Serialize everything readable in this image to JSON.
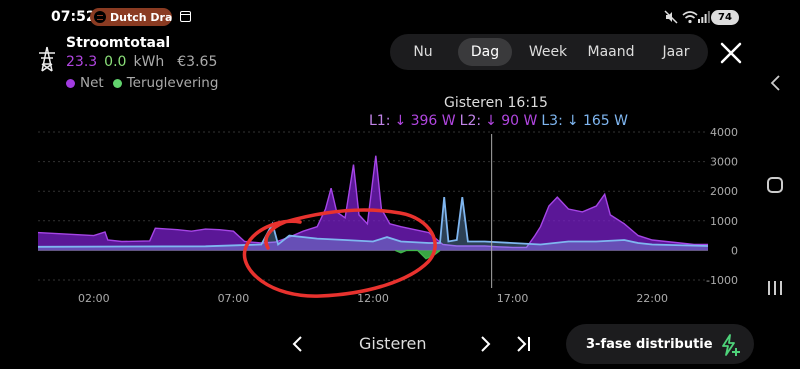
{
  "status_bar": {
    "time": "07:52",
    "notification": "Dutch Drag",
    "battery": "74"
  },
  "header": {
    "title": "Stroomtotaal",
    "net_value": "23.3",
    "return_value": "0.0",
    "unit": "kWh",
    "cost": "€3.65",
    "legend_net": "Net",
    "legend_return": "Teruglevering"
  },
  "tabs": [
    "Nu",
    "Dag",
    "Week",
    "Maand",
    "Jaar"
  ],
  "selected_tab": "Dag",
  "tooltip": {
    "time": "Gisteren 16:15",
    "l1_label": "L1:",
    "l1_value": "↓ 396 W",
    "l2_label": "L2:",
    "l2_value": "↓ 90 W",
    "l3_label": "L3:",
    "l3_value": "↓ 165 W"
  },
  "chart_data": {
    "type": "area",
    "y_ticks": [
      "4000",
      "3000",
      "2000",
      "1000",
      "0",
      "-1000"
    ],
    "ylim": [
      -1000,
      4000
    ],
    "x_ticks": [
      "02:00",
      "07:00",
      "12:00",
      "17:00",
      "22:00"
    ],
    "xlim_hours": [
      0,
      24
    ],
    "cursor_hour": 16.25,
    "series": [
      {
        "name": "Net",
        "color": "#7a1fc9",
        "values": [
          [
            0,
            600
          ],
          [
            1,
            550
          ],
          [
            2,
            500
          ],
          [
            2.4,
            620
          ],
          [
            2.5,
            350
          ],
          [
            3,
            300
          ],
          [
            4,
            320
          ],
          [
            4.2,
            750
          ],
          [
            5,
            700
          ],
          [
            5.5,
            650
          ],
          [
            6,
            720
          ],
          [
            6.5,
            700
          ],
          [
            7,
            650
          ],
          [
            7.4,
            300
          ],
          [
            8,
            250
          ],
          [
            8.5,
            280
          ],
          [
            9,
            450
          ],
          [
            9.5,
            650
          ],
          [
            10,
            800
          ],
          [
            10.3,
            1400
          ],
          [
            10.5,
            2100
          ],
          [
            10.7,
            1300
          ],
          [
            11,
            1100
          ],
          [
            11.3,
            2900
          ],
          [
            11.5,
            1200
          ],
          [
            11.8,
            900
          ],
          [
            12.1,
            3200
          ],
          [
            12.3,
            1400
          ],
          [
            12.6,
            900
          ],
          [
            13,
            800
          ],
          [
            13.5,
            700
          ],
          [
            14,
            600
          ],
          [
            14.5,
            200
          ],
          [
            15,
            150
          ],
          [
            16,
            150
          ],
          [
            16.5,
            120
          ],
          [
            17,
            100
          ],
          [
            17.5,
            100
          ],
          [
            17.8,
            500
          ],
          [
            18,
            800
          ],
          [
            18.3,
            1500
          ],
          [
            18.6,
            1800
          ],
          [
            19,
            1400
          ],
          [
            19.5,
            1300
          ],
          [
            20,
            1500
          ],
          [
            20.3,
            1900
          ],
          [
            20.5,
            1200
          ],
          [
            21,
            900
          ],
          [
            21.5,
            500
          ],
          [
            22,
            350
          ],
          [
            23,
            250
          ],
          [
            23.5,
            200
          ],
          [
            24,
            200
          ]
        ]
      },
      {
        "name": "L3",
        "color": "#7fb6f0",
        "values": [
          [
            0,
            120
          ],
          [
            6,
            140
          ],
          [
            8,
            200
          ],
          [
            8.4,
            900
          ],
          [
            8.6,
            200
          ],
          [
            9,
            500
          ],
          [
            10,
            400
          ],
          [
            11,
            350
          ],
          [
            12,
            300
          ],
          [
            12.5,
            450
          ],
          [
            13,
            300
          ],
          [
            14,
            250
          ],
          [
            14.4,
            250
          ],
          [
            14.55,
            1800
          ],
          [
            14.7,
            300
          ],
          [
            15,
            350
          ],
          [
            15.2,
            1800
          ],
          [
            15.4,
            300
          ],
          [
            16,
            300
          ],
          [
            17,
            250
          ],
          [
            18,
            200
          ],
          [
            19,
            300
          ],
          [
            20,
            300
          ],
          [
            21,
            350
          ],
          [
            21.5,
            250
          ],
          [
            22,
            200
          ],
          [
            24,
            150
          ]
        ]
      },
      {
        "name": "Teruglevering",
        "color": "#3fb74a",
        "values": [
          [
            12.8,
            0
          ],
          [
            13,
            -80
          ],
          [
            13.2,
            0
          ],
          [
            13.6,
            0
          ],
          [
            13.9,
            -280
          ],
          [
            14.2,
            -150
          ],
          [
            14.4,
            0
          ]
        ]
      }
    ]
  },
  "bottom": {
    "period_label": "Gisteren",
    "phase_button": "3-fase distributie"
  }
}
